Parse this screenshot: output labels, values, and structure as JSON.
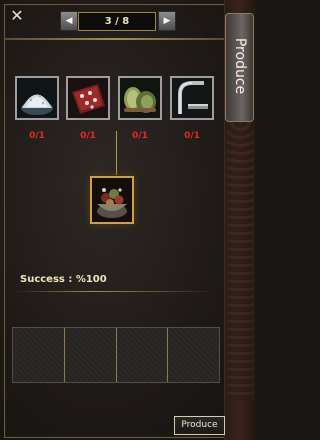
{
  "header": {
    "page_indicator": "3 / 8",
    "prev_glyph": "◀",
    "next_glyph": "▶",
    "close_glyph": "✕",
    "tab_label": "Produce"
  },
  "ingredients": [
    {
      "name": "salt-pile-icon",
      "count": "0/1"
    },
    {
      "name": "raw-meat-icon",
      "count": "0/1"
    },
    {
      "name": "herb-leaves-icon",
      "count": "0/1"
    },
    {
      "name": "metal-hook-icon",
      "count": "0/1"
    }
  ],
  "result": {
    "icon": "cooked-dish-icon"
  },
  "success_text": "Success : %100",
  "slots": [
    {
      "content": ""
    },
    {
      "content": ""
    },
    {
      "content": ""
    },
    {
      "content": ""
    }
  ],
  "produce_button_label": "Produce",
  "colors": {
    "count_text": "#e52a1e",
    "gold_border": "#c9a24a",
    "success_text": "#f1e5b8"
  }
}
